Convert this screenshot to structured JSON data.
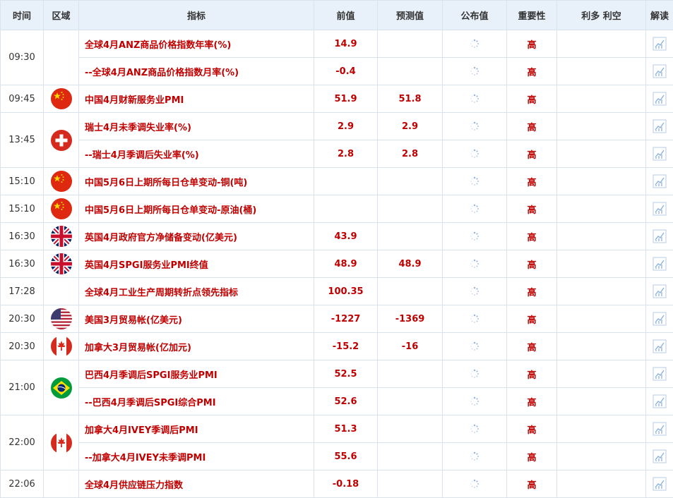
{
  "headers": {
    "time": "时间",
    "region": "区域",
    "indicator": "指标",
    "previous": "前值",
    "forecast": "预测值",
    "actual": "公布值",
    "importance": "重要性",
    "effect": "利多 利空",
    "analysis": "解读"
  },
  "rows": [
    {
      "time": "09:30",
      "indicator": "全球4月ANZ商品价格指数年率(%)",
      "previous": "14.9",
      "forecast": "",
      "importance": "高"
    },
    {
      "time": "",
      "indicator": "--全球4月ANZ商品价格指数月率(%)",
      "previous": "-0.4",
      "forecast": "",
      "importance": "高"
    },
    {
      "time": "09:45",
      "indicator": "中国4月财新服务业PMI",
      "previous": "51.9",
      "forecast": "51.8",
      "importance": "高"
    },
    {
      "time": "13:45",
      "indicator": "瑞士4月未季调失业率(%)",
      "previous": "2.9",
      "forecast": "2.9",
      "importance": "高"
    },
    {
      "time": "",
      "indicator": "--瑞士4月季调后失业率(%)",
      "previous": "2.8",
      "forecast": "2.8",
      "importance": "高"
    },
    {
      "time": "15:10",
      "indicator": "中国5月6日上期所每日仓单变动-铜(吨)",
      "previous": "",
      "forecast": "",
      "importance": "高"
    },
    {
      "time": "15:10",
      "indicator": "中国5月6日上期所每日仓单变动-原油(桶)",
      "previous": "",
      "forecast": "",
      "importance": "高"
    },
    {
      "time": "16:30",
      "indicator": "英国4月政府官方净储备变动(亿美元)",
      "previous": "43.9",
      "forecast": "",
      "importance": "高"
    },
    {
      "time": "16:30",
      "indicator": "英国4月SPGI服务业PMI终值",
      "previous": "48.9",
      "forecast": "48.9",
      "importance": "高"
    },
    {
      "time": "17:28",
      "indicator": "全球4月工业生产周期转折点领先指标",
      "previous": "100.35",
      "forecast": "",
      "importance": "高"
    },
    {
      "time": "20:30",
      "indicator": "美国3月贸易帐(亿美元)",
      "previous": "-1227",
      "forecast": "-1369",
      "importance": "高"
    },
    {
      "time": "20:30",
      "indicator": "加拿大3月贸易帐(亿加元)",
      "previous": "-15.2",
      "forecast": "-16",
      "importance": "高"
    },
    {
      "time": "21:00",
      "indicator": "巴西4月季调后SPGI服务业PMI",
      "previous": "52.5",
      "forecast": "",
      "importance": "高"
    },
    {
      "time": "",
      "indicator": "--巴西4月季调后SPGI综合PMI",
      "previous": "52.6",
      "forecast": "",
      "importance": "高"
    },
    {
      "time": "22:00",
      "indicator": "加拿大4月IVEY季调后PMI",
      "previous": "51.3",
      "forecast": "",
      "importance": "高"
    },
    {
      "time": "",
      "indicator": "--加拿大4月IVEY未季调PMI",
      "previous": "55.6",
      "forecast": "",
      "importance": "高"
    },
    {
      "time": "22:06",
      "indicator": "全球4月供应链压力指数",
      "previous": "-0.18",
      "forecast": "",
      "importance": "高"
    }
  ],
  "groups": [
    {
      "rows": [
        0,
        1
      ],
      "flag": ""
    },
    {
      "rows": [
        2
      ],
      "flag": "china-flag-icon"
    },
    {
      "rows": [
        3,
        4
      ],
      "flag": "switzerland-flag-icon"
    },
    {
      "rows": [
        5
      ],
      "flag": "china-flag-icon"
    },
    {
      "rows": [
        6
      ],
      "flag": "china-flag-icon"
    },
    {
      "rows": [
        7
      ],
      "flag": "uk-flag-icon"
    },
    {
      "rows": [
        8
      ],
      "flag": "uk-flag-icon"
    },
    {
      "rows": [
        9
      ],
      "flag": ""
    },
    {
      "rows": [
        10
      ],
      "flag": "usa-flag-icon"
    },
    {
      "rows": [
        11
      ],
      "flag": "canada-flag-icon"
    },
    {
      "rows": [
        12,
        13
      ],
      "flag": "brazil-flag-icon"
    },
    {
      "rows": [
        14,
        15
      ],
      "flag": "canada-flag-icon"
    },
    {
      "rows": [
        16
      ],
      "flag": ""
    }
  ],
  "icons": {
    "actual": "loading-spinner-icon",
    "analysis": "chart-analysis-icon"
  },
  "colors": {
    "header_bg": "#e8f0fa",
    "border": "#d9e3ee",
    "value_red": "#c00000"
  }
}
